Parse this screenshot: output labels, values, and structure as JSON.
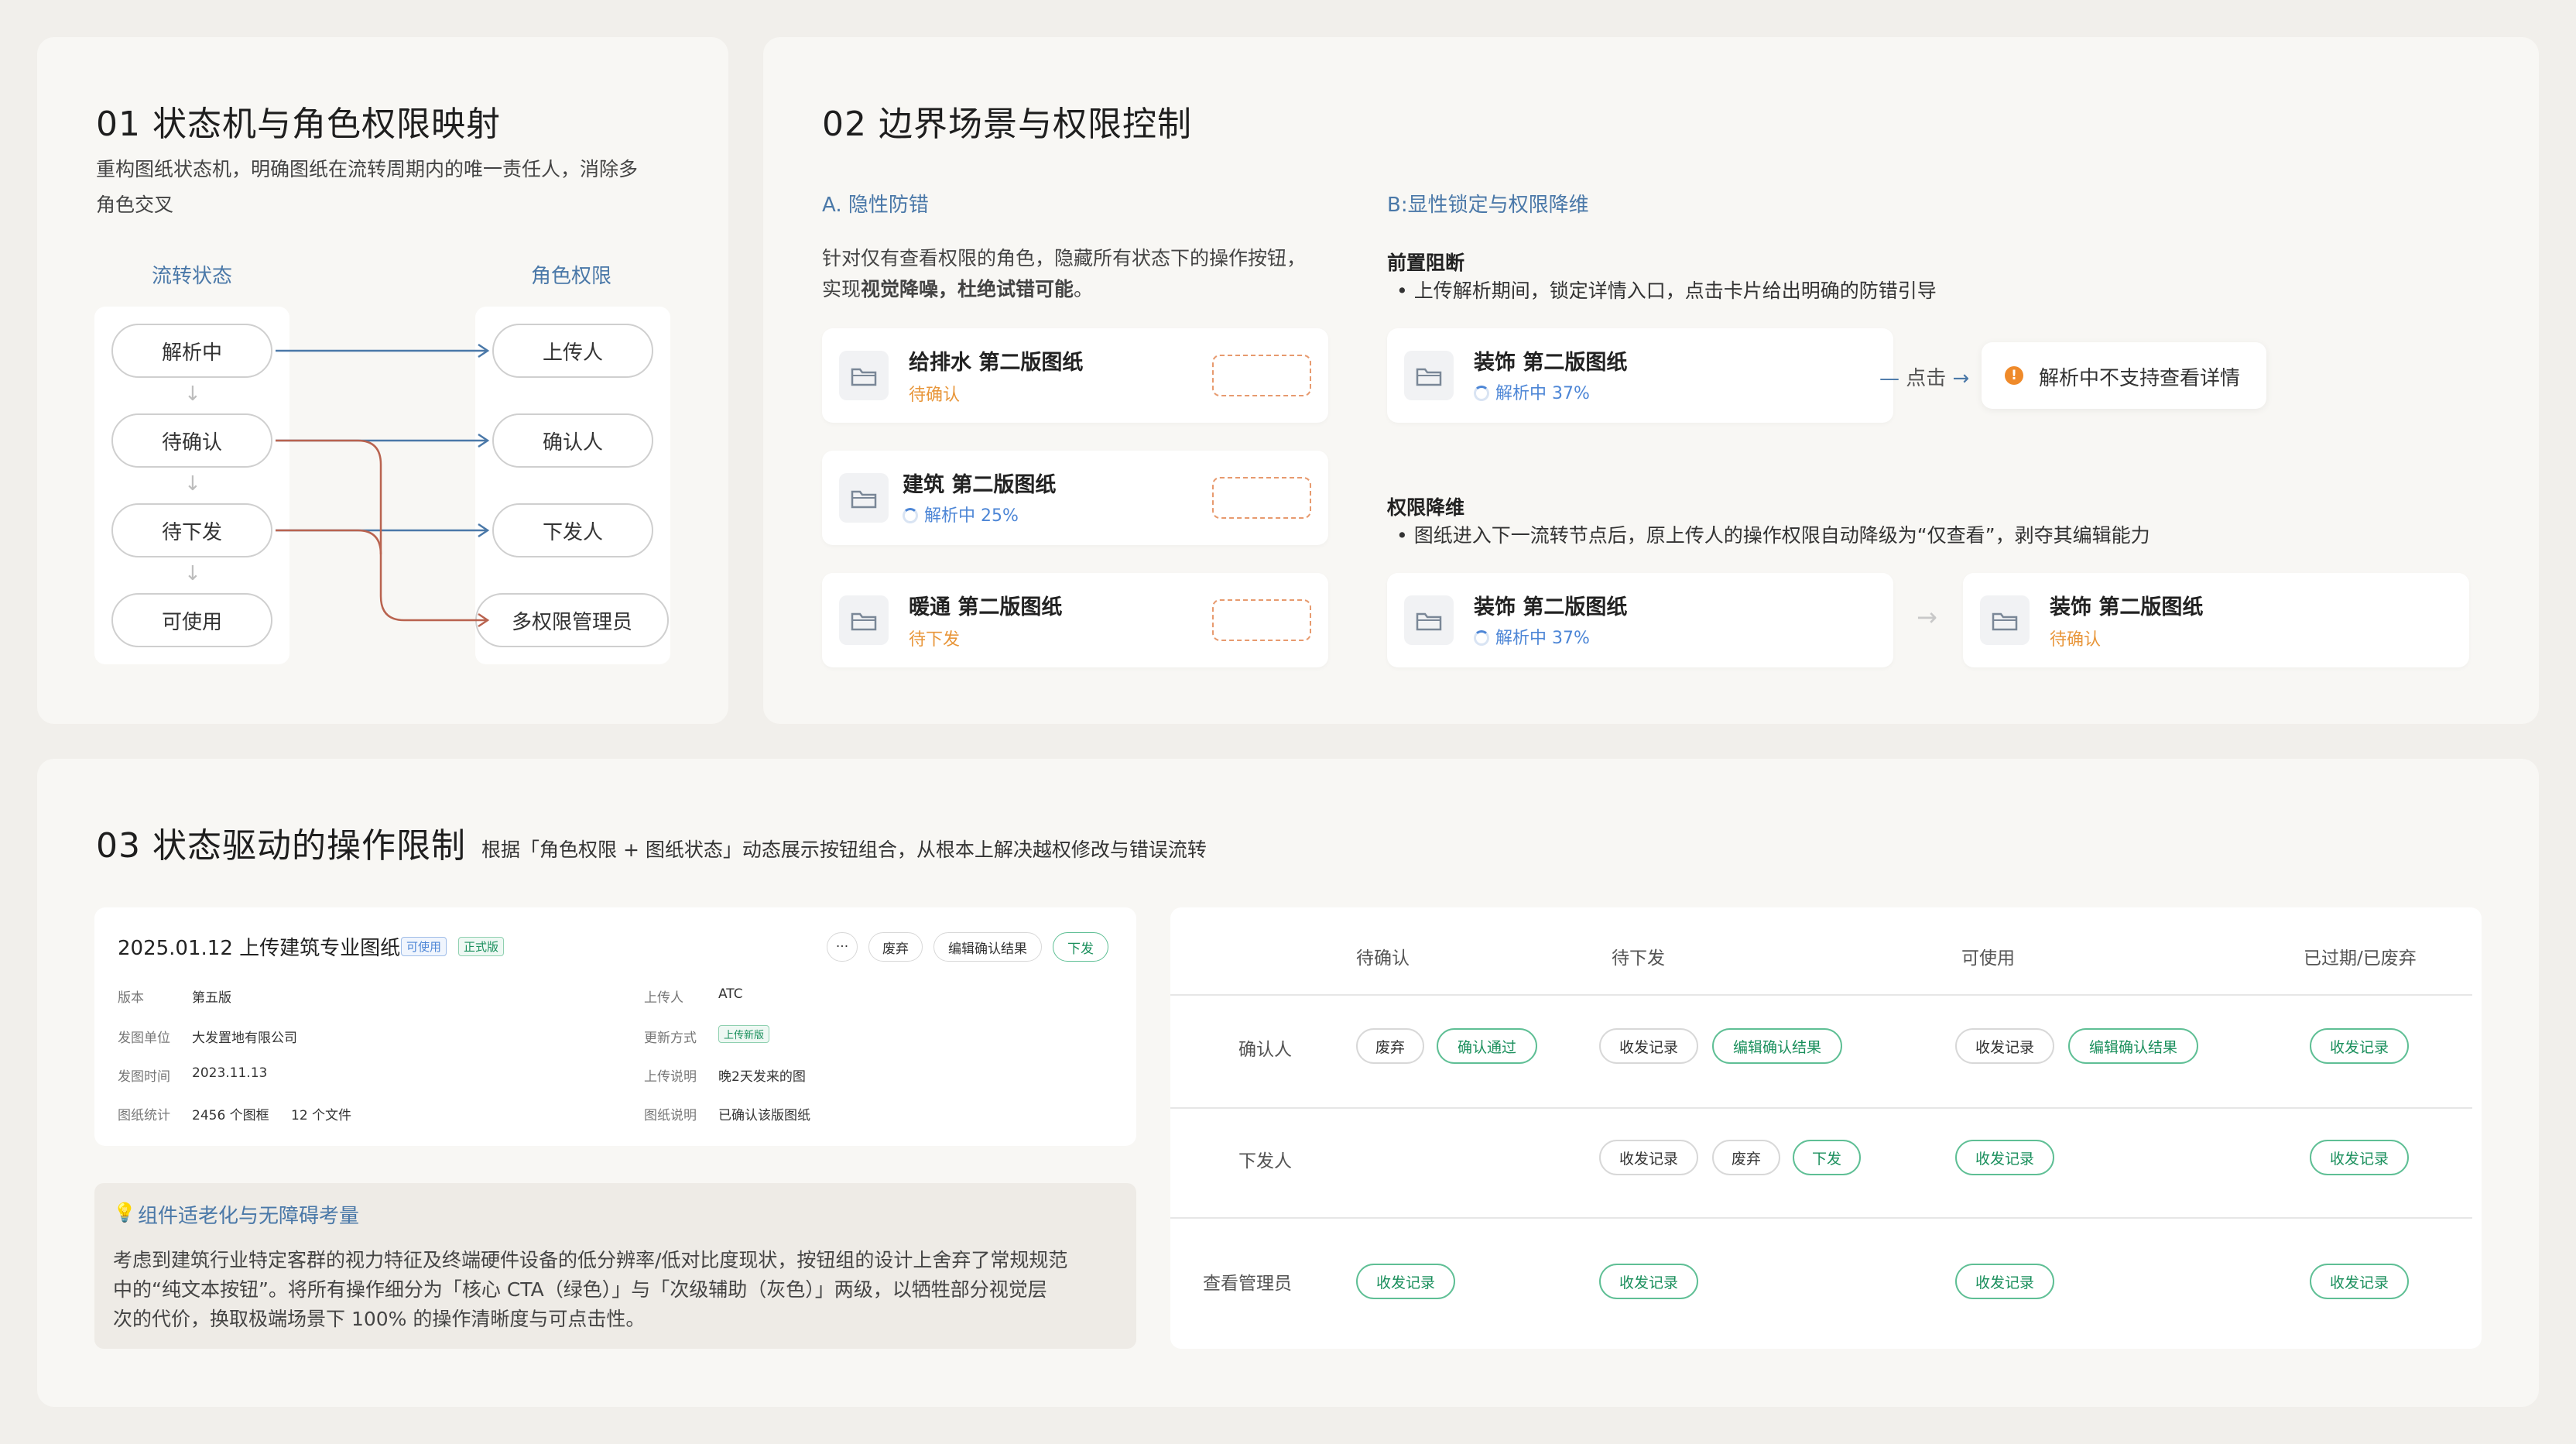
{
  "section1": {
    "title": "01 状态机与角色权限映射",
    "desc_line1": "重构图纸状态机，明确图纸在流转周期内的唯一责任人，消除多",
    "desc_line2": "角色交叉",
    "col_left": "流转状态",
    "col_right": "角色权限",
    "states": [
      "解析中",
      "待确认",
      "待下发",
      "可使用"
    ],
    "roles": [
      "上传人",
      "确认人",
      "下发人",
      "多权限管理员"
    ],
    "colors": {
      "blue_line": "#4a78a8",
      "red_line": "#b9634f"
    }
  },
  "section2": {
    "title": "02 边界场景与权限控制",
    "a_title": "A. 隐性防错",
    "a_desc_line1": "针对仅有查看权限的角色，隐藏所有状态下的操作按钮，",
    "a_desc_line2_pre": "实现",
    "a_desc_line2_bold": "视觉降噪，杜绝试错可能",
    "a_desc_line2_post": "。",
    "a_cards": [
      {
        "title": "给排水 第二版图纸",
        "status": "待确认"
      },
      {
        "title": "建筑 第二版图纸",
        "status": "解析中 25%"
      },
      {
        "title": "暖通 第二版图纸",
        "status": "待下发"
      }
    ],
    "b_title": "B:显性锁定与权限降维",
    "b1_heading": "前置阻断",
    "b1_bullet": "上传解析期间，锁定详情入口，点击卡片给出明确的防错引导",
    "b1_card": {
      "title": "装饰 第二版图纸",
      "status": "解析中 37%"
    },
    "b1_click": "点击",
    "b1_toast": "解析中不支持查看详情",
    "b2_heading": "权限降维",
    "b2_bullet": "图纸进入下一流转节点后，原上传人的操作权限自动降级为“仅查看”，剥夺其编辑能力",
    "b2_card_before": {
      "title": "装饰 第二版图纸",
      "status": "解析中 37%"
    },
    "b2_card_after": {
      "title": "装饰 第二版图纸",
      "status": "待确认"
    }
  },
  "section3": {
    "title": "03 状态驱动的操作限制",
    "subtitle": "根据「角色权限 + 图纸状态」动态展示按钮组合，从根本上解决越权修改与错误流转",
    "detail": {
      "title": "2025.01.12 上传建筑专业图纸",
      "tag_usable": "可使用",
      "tag_official": "正式版",
      "more": "···",
      "btn_discard": "废弃",
      "btn_edit": "编辑确认结果",
      "btn_issue": "下发",
      "left_fields": [
        {
          "label": "版本",
          "value": "第五版"
        },
        {
          "label": "发图单位",
          "value": "大发置地有限公司"
        },
        {
          "label": "发图时间",
          "value": "2023.11.13"
        },
        {
          "label": "图纸统计",
          "value": "2456 个图框",
          "value2": "12 个文件"
        }
      ],
      "right_fields": [
        {
          "label": "上传人",
          "value": "ATC"
        },
        {
          "label": "更新方式",
          "value": "上传新版"
        },
        {
          "label": "上传说明",
          "value": "晚2天发来的图"
        },
        {
          "label": "图纸说明",
          "value": "已确认该版图纸"
        }
      ]
    },
    "note": {
      "title": "组件适老化与无障碍考量",
      "line1": "考虑到建筑行业特定客群的视力特征及终端硬件设备的低分辨率/低对比度现状，按钮组的设计上舍弃了常规规范",
      "line2": "中的“纯文本按钮”。将所有操作细分为「核心 CTA（绿色）」与「次级辅助（灰色）」两级，以牺牲部分视觉层",
      "line3": "次的代价，换取极端场景下 100% 的操作清晰度与可点击性。"
    },
    "matrix": {
      "headers": [
        "待确认",
        "待下发",
        "可使用",
        "已过期/已废弃"
      ],
      "rows": [
        {
          "role": "确认人",
          "b1": "废弃",
          "b2": "确认通过",
          "b3": "收发记录",
          "b4": "编辑确认结果",
          "b5": "收发记录",
          "b6": "编辑确认结果",
          "b7": "收发记录"
        },
        {
          "role": "下发人",
          "b3": "收发记录",
          "b4": "废弃",
          "b5": "下发",
          "b6": "收发记录",
          "b7": "收发记录"
        },
        {
          "role": "查看管理员",
          "b1": "收发记录",
          "b3": "收发记录",
          "b5": "收发记录",
          "b7": "收发记录"
        }
      ]
    }
  }
}
